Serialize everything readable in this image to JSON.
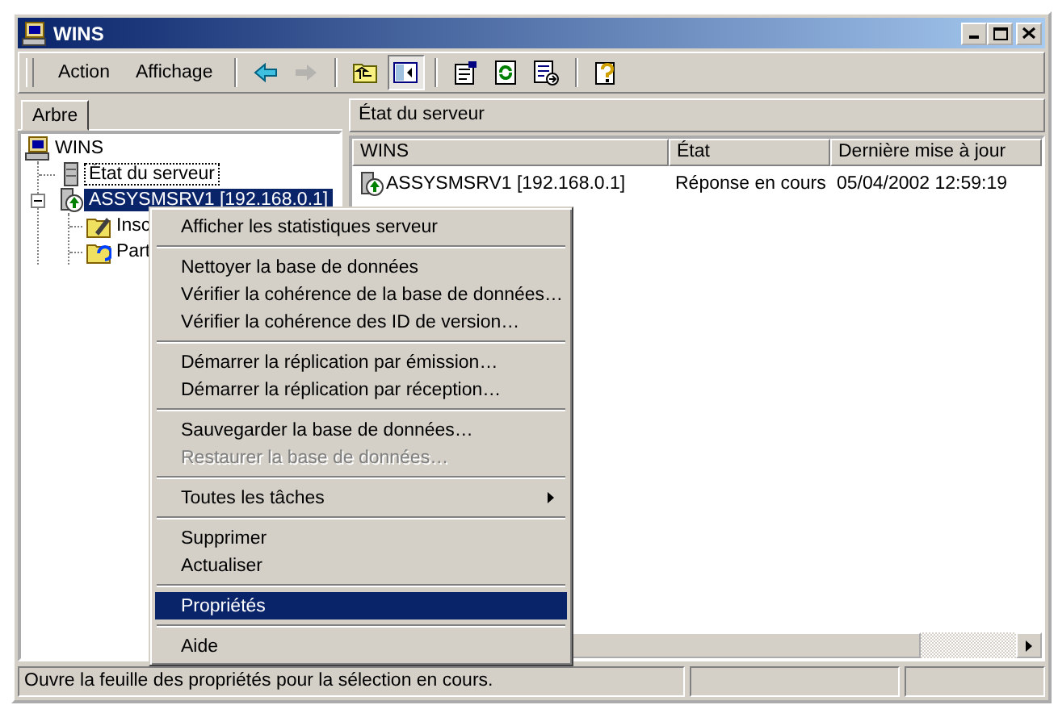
{
  "window": {
    "title": "WINS"
  },
  "menu": [
    {
      "label": "Action"
    },
    {
      "label": "Affichage"
    }
  ],
  "toolbar": [
    {
      "kind": "back",
      "disabled": false
    },
    {
      "kind": "forward",
      "disabled": true
    },
    {
      "kind": "sep"
    },
    {
      "kind": "up",
      "disabled": false
    },
    {
      "kind": "panes",
      "disabled": false,
      "on": true
    },
    {
      "kind": "sep"
    },
    {
      "kind": "properties",
      "disabled": false
    },
    {
      "kind": "refresh",
      "disabled": false
    },
    {
      "kind": "export",
      "disabled": false
    },
    {
      "kind": "sep"
    },
    {
      "kind": "help",
      "disabled": false
    }
  ],
  "tabs": [
    {
      "label": "Arbre",
      "selected": true
    }
  ],
  "tree": [
    {
      "label": "WINS",
      "kind": "wins",
      "selected": false,
      "focused": false,
      "children": [
        {
          "label": "État du serveur",
          "kind": "status",
          "selected": false,
          "focused": true
        },
        {
          "label": "ASSYSMSRV1 [192.168.0.1]",
          "kind": "server",
          "selected": true,
          "focused": false,
          "expanded": true,
          "children": [
            {
              "label": "Insc",
              "kind": "folder",
              "selected": false,
              "focused": false
            },
            {
              "label": "Part",
              "kind": "partners",
              "selected": false,
              "focused": false
            }
          ]
        }
      ]
    }
  ],
  "pane_title": "État du serveur",
  "table": {
    "columns": [
      "WINS",
      "État",
      "Dernière mise à jour"
    ],
    "rows": [
      {
        "cells": [
          "ASSYSMSRV1 [192.168.0.1]",
          "Réponse en cours",
          "05/04/2002 12:59:19"
        ]
      }
    ]
  },
  "context_menu": [
    {
      "kind": "item",
      "label": "Afficher les statistiques serveur",
      "disabled": false,
      "selected": false
    },
    {
      "kind": "separator"
    },
    {
      "kind": "item",
      "label": "Nettoyer la base de données",
      "disabled": false,
      "selected": false
    },
    {
      "kind": "item",
      "label": "Vérifier la cohérence de la base de données…",
      "disabled": false,
      "selected": false
    },
    {
      "kind": "item",
      "label": "Vérifier la cohérence des ID de version…",
      "disabled": false,
      "selected": false
    },
    {
      "kind": "separator"
    },
    {
      "kind": "item",
      "label": "Démarrer la réplication par émission…",
      "disabled": false,
      "selected": false
    },
    {
      "kind": "item",
      "label": "Démarrer la réplication par réception…",
      "disabled": false,
      "selected": false
    },
    {
      "kind": "separator"
    },
    {
      "kind": "item",
      "label": "Sauvegarder la base de données…",
      "disabled": false,
      "selected": false
    },
    {
      "kind": "item",
      "label": "Restaurer la base de données…",
      "disabled": true,
      "selected": false
    },
    {
      "kind": "separator"
    },
    {
      "kind": "submenu",
      "label": "Toutes les tâches",
      "disabled": false,
      "selected": false
    },
    {
      "kind": "separator"
    },
    {
      "kind": "item",
      "label": "Supprimer",
      "disabled": false,
      "selected": false
    },
    {
      "kind": "item",
      "label": "Actualiser",
      "disabled": false,
      "selected": false
    },
    {
      "kind": "separator"
    },
    {
      "kind": "item",
      "label": "Propriétés",
      "disabled": false,
      "selected": true
    },
    {
      "kind": "separator"
    },
    {
      "kind": "item",
      "label": "Aide",
      "disabled": false,
      "selected": false
    }
  ],
  "status_bar": {
    "text": "Ouvre la feuille des propriétés pour la sélection en cours."
  }
}
